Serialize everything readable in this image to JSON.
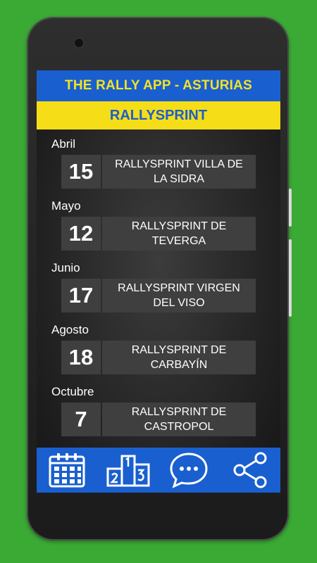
{
  "header": {
    "app_title": "THE RALLY APP - ASTURIAS",
    "section_title": "RALLYSPRINT"
  },
  "events": [
    {
      "month": "Abril",
      "day": "15",
      "name_line1": "RALLYSPRINT VILLA DE",
      "name_line2": "LA SIDRA"
    },
    {
      "month": "Mayo",
      "day": "12",
      "name_line1": "RALLYSPRINT DE",
      "name_line2": "TEVERGA"
    },
    {
      "month": "Junio",
      "day": "17",
      "name_line1": "RALLYSPRINT VIRGEN",
      "name_line2": "DEL VISO"
    },
    {
      "month": "Agosto",
      "day": "18",
      "name_line1": "RALLYSPRINT DE",
      "name_line2": "CARBAYÍN"
    },
    {
      "month": "Octubre",
      "day": "7",
      "name_line1": "RALLYSPRINT DE",
      "name_line2": "CASTROPOL"
    }
  ],
  "bottom_nav": {
    "items": [
      {
        "icon": "calendar-icon"
      },
      {
        "icon": "podium-icon"
      },
      {
        "icon": "chat-icon"
      },
      {
        "icon": "share-icon"
      }
    ]
  },
  "colors": {
    "background_green": "#3aaa35",
    "brand_blue": "#1a5fcf",
    "brand_yellow": "#f5de17"
  }
}
